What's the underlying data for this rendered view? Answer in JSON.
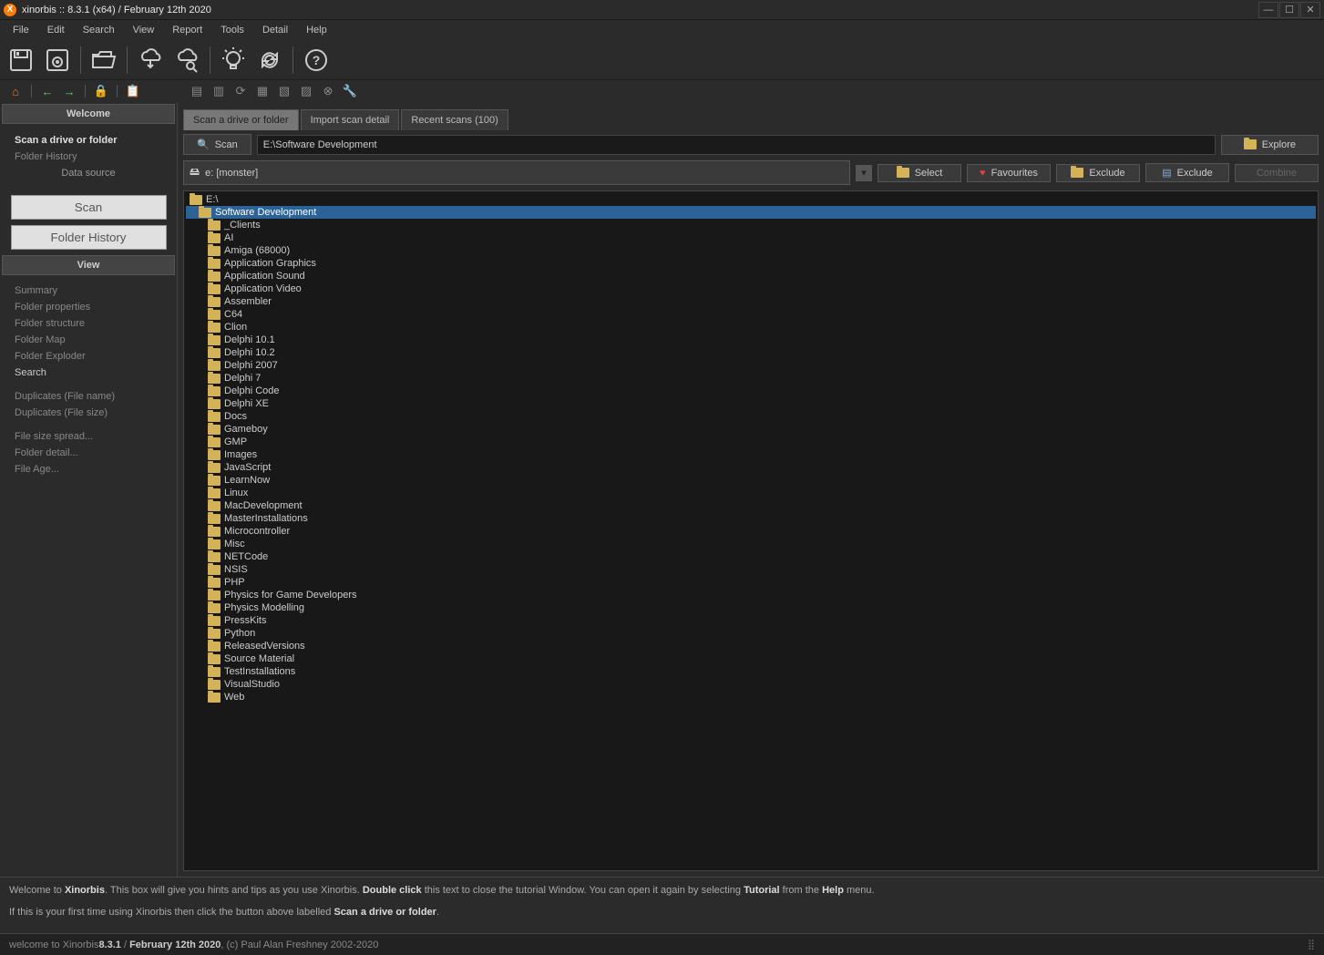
{
  "title": "xinorbis :: 8.3.1 (x64) / February 12th 2020",
  "menu": [
    "File",
    "Edit",
    "Search",
    "View",
    "Report",
    "Tools",
    "Detail",
    "Help"
  ],
  "sidebar": {
    "welcome": "Welcome",
    "scan_label": "Scan a drive or folder",
    "folder_history": "Folder History",
    "data_source": "Data source",
    "scan_btn": "Scan",
    "history_btn": "Folder History",
    "view": "View",
    "items": [
      "Summary",
      "Folder properties",
      "Folder structure",
      "Folder Map",
      "Folder Exploder",
      "Search",
      "",
      "Duplicates (File name)",
      "Duplicates (File size)",
      "",
      "File size spread...",
      "Folder detail...",
      "File Age..."
    ]
  },
  "tabs": {
    "scan": "Scan a drive or folder",
    "import": "Import scan detail",
    "recent": "Recent scans (100)"
  },
  "scanbar": {
    "scan": "Scan",
    "path": "E:\\Software Development",
    "explore": "Explore"
  },
  "drivebar": {
    "drive": "e: [monster]",
    "select": "Select",
    "favourites": "Favourites",
    "exclude1": "Exclude",
    "exclude2": "Exclude",
    "combine": "Combine"
  },
  "tree_root": "E:\\",
  "tree_selected": "Software Development",
  "tree_children": [
    "_Clients",
    "AI",
    "Amiga (68000)",
    "Application Graphics",
    "Application Sound",
    "Application Video",
    "Assembler",
    "C64",
    "Clion",
    "Delphi 10.1",
    "Delphi 10.2",
    "Delphi 2007",
    "Delphi 7",
    "Delphi Code",
    "Delphi XE",
    "Docs",
    "Gameboy",
    "GMP",
    "Images",
    "JavaScript",
    "LearnNow",
    "Linux",
    "MacDevelopment",
    "MasterInstallations",
    "Microcontroller",
    "Misc",
    "NETCode",
    "NSIS",
    "PHP",
    "Physics for Game Developers",
    "Physics Modelling",
    "PressKits",
    "Python",
    "ReleasedVersions",
    "Source Material",
    "TestInstallations",
    "VisualStudio",
    "Web"
  ],
  "hints": {
    "line1_1": "Welcome to ",
    "line1_b1": "Xinorbis",
    "line1_2": ". This box will give you hints and tips as you use Xinorbis. ",
    "line1_b2": "Double click",
    "line1_3": " this text to close the tutorial Window. You can open it again by selecting ",
    "line1_b3": "Tutorial",
    "line1_4": " from the ",
    "line1_b4": "Help",
    "line1_5": " menu.",
    "line2_1": "If this is your first time using Xinorbis then click the button above labelled ",
    "line2_b1": "Scan a drive or folder",
    "line2_2": "."
  },
  "status": {
    "prefix": "welcome to Xinorbis ",
    "ver": "8.3.1",
    "date": "February 12th 2020",
    "copy": ", (c) Paul Alan Freshney 2002-2020"
  }
}
